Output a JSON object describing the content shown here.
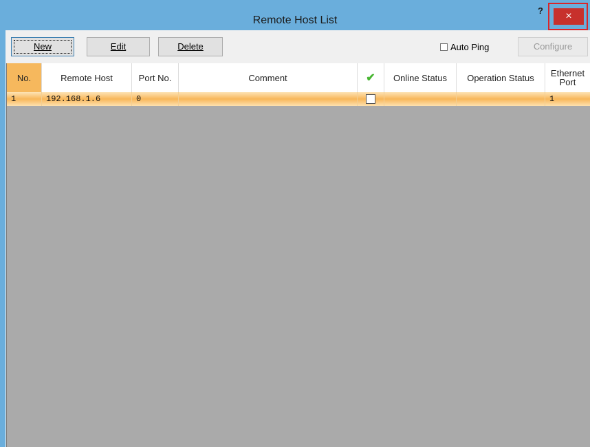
{
  "window": {
    "title": "Remote Host List",
    "help": "?",
    "close": "×"
  },
  "toolbar": {
    "new_label": "New",
    "edit_label": "Edit",
    "delete_label": "Delete",
    "auto_ping_label": "Auto Ping",
    "auto_ping_checked": false,
    "configure_label": "Configure"
  },
  "table": {
    "columns": [
      "No.",
      "Remote Host",
      "Port No.",
      "Comment",
      "✔",
      "Online Status",
      "Operation Status",
      "Ethernet Port"
    ],
    "rows": [
      {
        "no": "1",
        "remote_host": "192.168.1.6",
        "port": "0",
        "comment": "",
        "checked": false,
        "online_status": "",
        "operation_status": "",
        "ethernet_port": "1"
      }
    ]
  },
  "colors": {
    "title_bar": "#6aaedc",
    "close_button": "#c7302c",
    "row_highlight": "#f8b75a",
    "header_no": "#f6b85d",
    "grid_background": "#aaaaaa",
    "check_icon": "#46b530"
  }
}
